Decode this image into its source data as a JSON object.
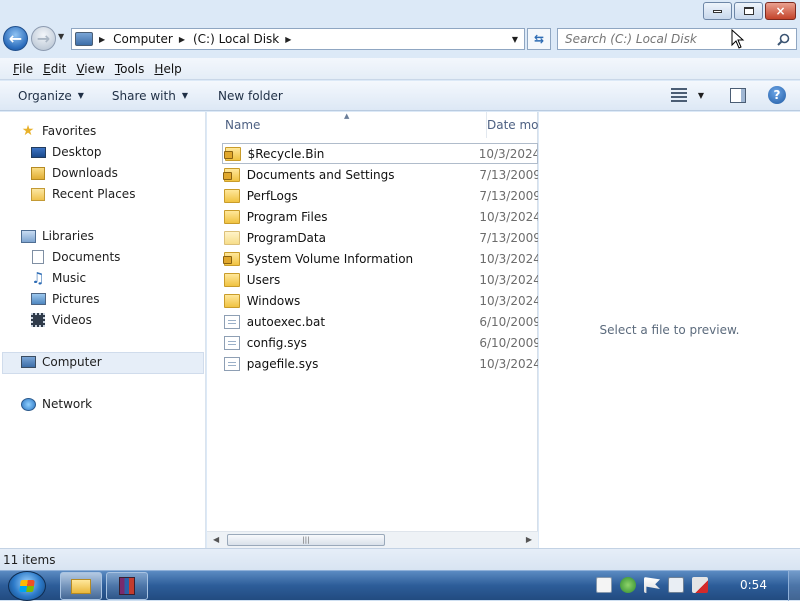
{
  "window": {
    "caption_buttons": {
      "minimize": "minimize",
      "maximize": "maximize",
      "close": "×"
    }
  },
  "address": {
    "breadcrumbs": [
      "Computer",
      "(C:) Local Disk"
    ],
    "search_placeholder": "Search (C:) Local Disk"
  },
  "menu": [
    "File",
    "Edit",
    "View",
    "Tools",
    "Help"
  ],
  "menu_underline": [
    "F",
    "E",
    "V",
    "T",
    "H"
  ],
  "commands": {
    "organize": "Organize",
    "share_with": "Share with",
    "new_folder": "New folder"
  },
  "nav": {
    "favorites": "Favorites",
    "desktop": "Desktop",
    "downloads": "Downloads",
    "recent_places": "Recent Places",
    "libraries": "Libraries",
    "documents": "Documents",
    "music": "Music",
    "pictures": "Pictures",
    "videos": "Videos",
    "computer": "Computer",
    "network": "Network"
  },
  "columns": {
    "name": "Name",
    "date": "Date mod"
  },
  "files": [
    {
      "name": "$Recycle.Bin",
      "date": "10/3/2024",
      "icon": "locked-folder-icon"
    },
    {
      "name": "Documents and Settings",
      "date": "7/13/2009",
      "icon": "locked-folder-icon"
    },
    {
      "name": "PerfLogs",
      "date": "7/13/2009",
      "icon": "folder-icon"
    },
    {
      "name": "Program Files",
      "date": "10/3/2024",
      "icon": "folder-icon"
    },
    {
      "name": "ProgramData",
      "date": "7/13/2009",
      "icon": "folder-icon"
    },
    {
      "name": "System Volume Information",
      "date": "10/3/2024",
      "icon": "locked-folder-icon"
    },
    {
      "name": "Users",
      "date": "10/3/2024",
      "icon": "folder-icon"
    },
    {
      "name": "Windows",
      "date": "10/3/2024",
      "icon": "folder-icon"
    },
    {
      "name": "autoexec.bat",
      "date": "6/10/2009",
      "icon": "file-icon"
    },
    {
      "name": "config.sys",
      "date": "6/10/2009",
      "icon": "file-icon"
    },
    {
      "name": "pagefile.sys",
      "date": "10/3/2024",
      "icon": "file-icon"
    }
  ],
  "preview_text": "Select a file to preview.",
  "status": "11 items",
  "taskbar": {
    "clock": "0:54"
  },
  "colors": {
    "accent": "#2a6bbb",
    "selection": "#e6eef8",
    "taskbar": "#2d5d99"
  }
}
